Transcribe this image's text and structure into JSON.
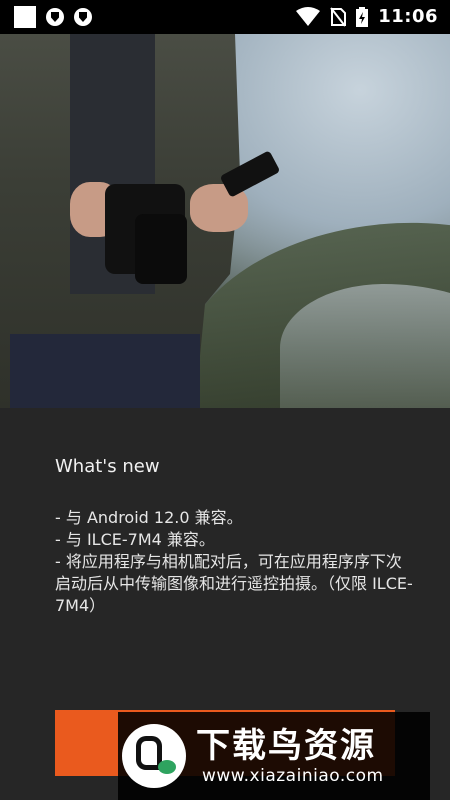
{
  "status_bar": {
    "time": "11:06",
    "icons": [
      "notification-square-icon",
      "vpn-shield-icon",
      "vpn-shield-icon",
      "wifi-icon",
      "no-sim-icon",
      "battery-charging-icon"
    ]
  },
  "hero": {
    "image": "photo-person-holding-camera-and-phone-outdoors"
  },
  "whats_new": {
    "title": "What's new",
    "notes": [
      "- 与 Android 12.0 兼容。",
      "- 与 ILCE-7M4 兼容。",
      "- 将应用程序与相机配对后，可在应用程序序下次启动后从中传输图像和进行遥控拍摄。（仅限 ILCE-7M4）"
    ]
  },
  "button": {
    "label": "",
    "color": "#ea5a1e"
  },
  "watermark": {
    "site_name": "下载鸟资源",
    "url": "www.xiazainiao.com"
  },
  "colors": {
    "background": "#262626",
    "accent": "#ea5a1e",
    "status_bar": "#000000"
  }
}
